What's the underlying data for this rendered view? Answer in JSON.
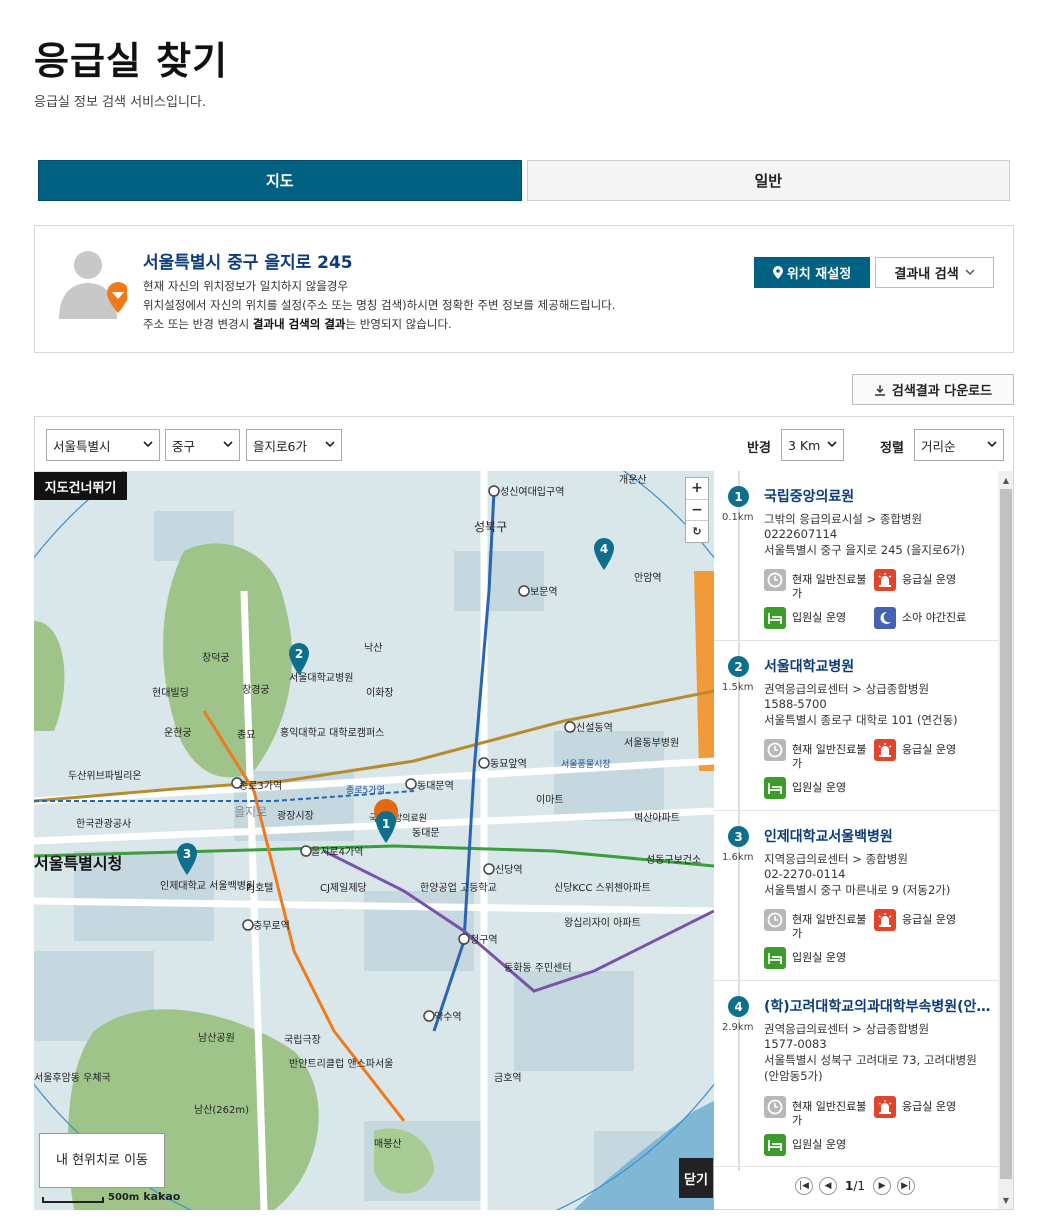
{
  "header": {
    "title": "응급실 찾기",
    "subtitle": "응급실 정보 검색 서비스입니다."
  },
  "tabs": [
    {
      "label": "지도",
      "active": true
    },
    {
      "label": "일반",
      "active": false
    }
  ],
  "location": {
    "address": "서울특별시 중구 을지로 245",
    "line1": "현재 자신의 위치정보가 일치하지 않을경우",
    "line2": "위치설정에서 자신의 위치를 설정(주소 또는 명칭 검색)하시면 정확한 주변 정보를 제공해드립니다.",
    "line3_pre": "주소 또는 반경 변경시 ",
    "line3_bold": "결과내 검색의 결과",
    "line3_post": "는 반영되지 않습니다.",
    "reset_button": "위치 재설정",
    "in_result_button": "결과내 검색"
  },
  "download_button": "검색결과 다운로드",
  "filters": {
    "city": "서울특별시",
    "district": "중구",
    "dong": "을지로6가",
    "radius_label": "반경",
    "radius": "3 Km",
    "sort_label": "정렬",
    "sort": "거리순"
  },
  "map": {
    "skip_label": "지도건너뛰기",
    "zoom_in": "+",
    "zoom_out": "−",
    "reset": "↻",
    "my_location": "내 현위치로 이동",
    "close": "닫기",
    "scale": "500m",
    "brand": "kakao",
    "markers": [
      "1",
      "2",
      "3",
      "4"
    ],
    "labels": {
      "l1": "국립중앙의료원",
      "l2": "서울특별시청",
      "l3": "동대문역",
      "l4": "을지로4가역",
      "l5": "종로3가역",
      "l6": "충무로역",
      "l7": "청구역",
      "l8": "신당역",
      "l9": "동묘앞역",
      "l10": "신설동역",
      "l11": "보문역",
      "l12": "성신여대입구역",
      "l13": "남산공원",
      "l14": "창덕궁",
      "l15": "창경궁",
      "l16": "낙산",
      "l17": "이화장",
      "l18": "현대빌딩",
      "l19": "약수역",
      "l20": "금호역",
      "l21": "인제대학교 서울백병원",
      "l22": "광장시장",
      "l23": "한국관광공사",
      "l24": "PJ호텔",
      "l25": "CJ제일제당",
      "l26": "두산위브파빌리온",
      "l27": "성북구",
      "l28": "동대문",
      "l29": "을지로",
      "l30": "이마트",
      "l31": "왕십리자이 아파트",
      "l32": "신당KCC 스위첸아파트",
      "l33": "한양공업 고등학교",
      "l34": "동화동 주민센터",
      "l35": "남산(262m)",
      "l36": "매봉산",
      "l37": "서울후암동 우체국",
      "l38": "국립극장",
      "l39": "반얀트리클럽 앤스파서울",
      "l40": "종로5가역",
      "l41": "서울풍물시장",
      "l42": "안암역",
      "l43": "서울동부병원",
      "l44": "벽산아파트",
      "l45": "성동구보건소",
      "l46": "서울대학교병원",
      "l47": "개운산",
      "l48": "운현궁",
      "l49": "종묘",
      "l50": "홍익대학교 대학로캠퍼스"
    }
  },
  "hospitals": [
    {
      "num": "1",
      "dist": "0.1km",
      "name": "국립중앙의료원",
      "type": "그밖의 응급의료시설 > 종합병원",
      "phone": "0222607114",
      "addr": "서울특별시 중구 을지로 245 (을지로6가)",
      "b1": "현재 일반진료불가",
      "b2": "응급실 운영",
      "b3": "입원실 운영",
      "b4": "소아 야간진료"
    },
    {
      "num": "2",
      "dist": "1.5km",
      "name": "서울대학교병원",
      "type": "권역응급의료센터 > 상급종합병원",
      "phone": "1588-5700",
      "addr": "서울특별시 종로구 대학로 101 (연건동)",
      "b1": "현재 일반진료불가",
      "b2": "응급실 운영",
      "b3": "입원실 운영"
    },
    {
      "num": "3",
      "dist": "1.6km",
      "name": "인제대학교서울백병원",
      "type": "지역응급의료센터 > 종합병원",
      "phone": "02-2270-0114",
      "addr": "서울특별시 중구 마른내로 9 (저동2가)",
      "b1": "현재 일반진료불가",
      "b2": "응급실 운영",
      "b3": "입원실 운영"
    },
    {
      "num": "4",
      "dist": "2.9km",
      "name": "(학)고려대학교의과대학부속병원(안암병원)",
      "type": "권역응급의료센터 > 상급종합병원",
      "phone": "1577-0083",
      "addr": "서울특별시 성북구 고려대로 73, 고려대병원 (안암동5가)",
      "b1": "현재 일반진료불가",
      "b2": "응급실 운영",
      "b3": "입원실 운영"
    }
  ],
  "pager": {
    "current": "1",
    "total": "/1"
  },
  "colors": {
    "primary": "#006182",
    "title_blue": "#0b3c7a",
    "marker_teal": "#0f6e8c",
    "marker_orange": "#e36a12"
  }
}
